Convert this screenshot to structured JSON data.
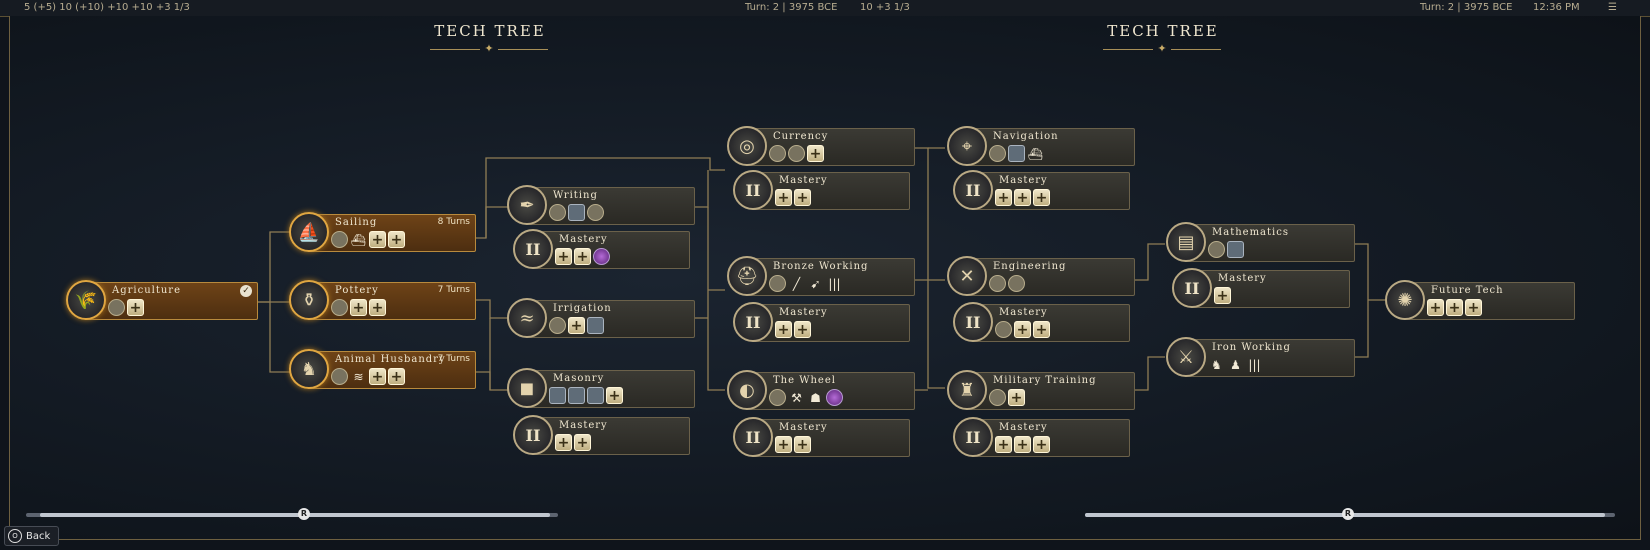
{
  "top_bar": {
    "left_stats": "5 (+5)   10 (+10)   +10   +10   +3   1/3",
    "center": "Turn: 2  |  3975 BCE",
    "center_stats": "10   +3   1/3",
    "right_turn": "Turn: 2  |  3975 BCE",
    "clock": "12:36 PM"
  },
  "titles": [
    "TECH TREE",
    "TECH TREE"
  ],
  "back_label": "Back",
  "scroll_button": "R",
  "techs": [
    {
      "id": "agriculture",
      "name": "Agriculture",
      "status": "researched",
      "checked": true,
      "turns": "",
      "icon": "wheat-icon",
      "glyph": "🌾",
      "unlocks": [
        "round",
        "plus"
      ]
    },
    {
      "id": "sailing",
      "name": "Sailing",
      "status": "queued",
      "turns": "8 Turns",
      "icon": "boat-icon",
      "glyph": "⛵",
      "unlocks": [
        "round",
        "glyph:⛴",
        "plus",
        "plus"
      ]
    },
    {
      "id": "pottery",
      "name": "Pottery",
      "status": "queued",
      "turns": "7 Turns",
      "icon": "pot-icon",
      "glyph": "⚱",
      "unlocks": [
        "round",
        "plus",
        "plus"
      ]
    },
    {
      "id": "animal_husbandry",
      "name": "Animal Husbandry",
      "status": "queued",
      "turns": "7 Turns",
      "icon": "horse-icon",
      "glyph": "♞",
      "unlocks": [
        "round",
        "glyph:≋",
        "plus",
        "plus"
      ]
    },
    {
      "id": "writing",
      "name": "Writing",
      "status": "available",
      "turns": "",
      "icon": "quill-icon",
      "glyph": "✒",
      "unlocks": [
        "round",
        "square",
        "round"
      ]
    },
    {
      "id": "irrigation",
      "name": "Irrigation",
      "status": "available",
      "turns": "",
      "icon": "canal-icon",
      "glyph": "≈",
      "unlocks": [
        "round",
        "plus",
        "square"
      ]
    },
    {
      "id": "masonry",
      "name": "Masonry",
      "status": "available",
      "turns": "",
      "icon": "stone-icon",
      "glyph": "◼",
      "unlocks": [
        "square",
        "square",
        "square",
        "plus"
      ]
    },
    {
      "id": "currency",
      "name": "Currency",
      "status": "available",
      "turns": "",
      "icon": "coin-icon",
      "glyph": "◎",
      "unlocks": [
        "round",
        "round",
        "plus"
      ]
    },
    {
      "id": "bronze_working",
      "name": "Bronze Working",
      "status": "available",
      "turns": "",
      "icon": "helmet-icon",
      "glyph": "⛑",
      "unlocks": [
        "round",
        "glyph:╱",
        "glyph:➹",
        "glyph:|||"
      ]
    },
    {
      "id": "the_wheel",
      "name": "The Wheel",
      "status": "available",
      "turns": "",
      "icon": "wheel-icon",
      "glyph": "◐",
      "unlocks": [
        "round",
        "glyph:⚒",
        "glyph:☗",
        "purple"
      ]
    },
    {
      "id": "navigation",
      "name": "Navigation",
      "status": "available",
      "turns": "",
      "icon": "sextant-icon",
      "glyph": "⌖",
      "unlocks": [
        "round",
        "square",
        "glyph:⛴"
      ]
    },
    {
      "id": "engineering",
      "name": "Engineering",
      "status": "available",
      "turns": "",
      "icon": "tools-icon",
      "glyph": "✕",
      "unlocks": [
        "round",
        "round"
      ]
    },
    {
      "id": "military_training",
      "name": "Military Training",
      "status": "available",
      "turns": "",
      "icon": "soldier-icon",
      "glyph": "♜",
      "unlocks": [
        "round",
        "plus"
      ]
    },
    {
      "id": "mathematics",
      "name": "Mathematics",
      "status": "available",
      "turns": "",
      "icon": "abacus-icon",
      "glyph": "▤",
      "unlocks": [
        "round",
        "square"
      ]
    },
    {
      "id": "iron_working",
      "name": "Iron Working",
      "status": "available",
      "turns": "",
      "icon": "anvil-icon",
      "glyph": "⚔",
      "unlocks": [
        "glyph:♞",
        "glyph:♟",
        "glyph:|||"
      ]
    },
    {
      "id": "future_tech",
      "name": "Future Tech",
      "status": "available",
      "turns": "",
      "icon": "future-icon",
      "glyph": "✺",
      "unlocks": [
        "plus",
        "plus",
        "plus"
      ]
    }
  ],
  "masteries": [
    {
      "id": "writing_mastery",
      "name": "Mastery",
      "numeral": "II",
      "unlocks": [
        "plus",
        "plus",
        "purple"
      ]
    },
    {
      "id": "irrigation_mastery",
      "name": "Mastery",
      "numeral": "II",
      "unlocks": [
        "plus",
        "plus"
      ]
    },
    {
      "id": "masonry_mastery",
      "name": "Mastery",
      "numeral": "II",
      "unlocks": [
        "plus",
        "plus"
      ]
    },
    {
      "id": "currency_mastery",
      "name": "Mastery",
      "numeral": "II",
      "unlocks": [
        "plus",
        "plus"
      ]
    },
    {
      "id": "bronze_working_mastery",
      "name": "Mastery",
      "numeral": "II",
      "unlocks": [
        "plus",
        "plus"
      ]
    },
    {
      "id": "the_wheel_mastery",
      "name": "Mastery",
      "numeral": "II",
      "unlocks": [
        "plus",
        "plus"
      ]
    },
    {
      "id": "navigation_mastery",
      "name": "Mastery",
      "numeral": "II",
      "unlocks": [
        "plus",
        "plus",
        "plus"
      ]
    },
    {
      "id": "engineering_mastery",
      "name": "Mastery",
      "numeral": "II",
      "unlocks": [
        "round",
        "plus",
        "plus"
      ]
    },
    {
      "id": "military_training_mastery",
      "name": "Mastery",
      "numeral": "II",
      "unlocks": [
        "plus",
        "plus",
        "plus"
      ]
    },
    {
      "id": "mathematics_mastery",
      "name": "Mastery",
      "numeral": "II",
      "unlocks": [
        "plus"
      ]
    }
  ]
}
